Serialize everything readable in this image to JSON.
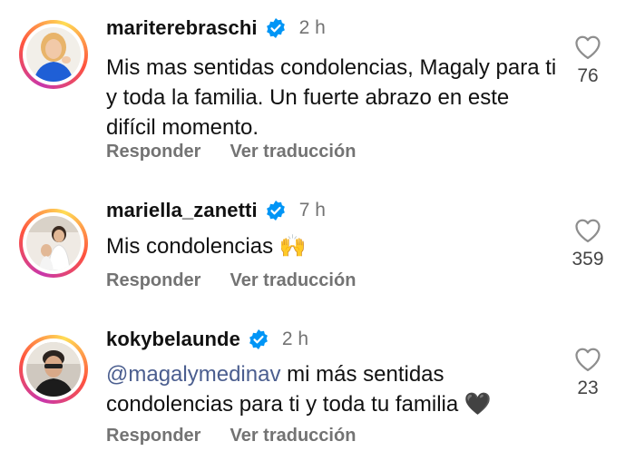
{
  "comments": [
    {
      "username": "mariterebraschi",
      "time": "2 h",
      "text": "Mis mas sentidas condolencias, Magaly para ti y toda la familia. Un fuerte abrazo en este difícil momento.",
      "likes": "76",
      "reply_label": "Responder",
      "translate_label": "Ver traducción"
    },
    {
      "username": "mariella_zanetti",
      "time": "7 h",
      "text": "Mis condolencias 🙌",
      "likes": "359",
      "reply_label": "Responder",
      "translate_label": "Ver traducción"
    },
    {
      "username": "kokybelaunde",
      "time": "2 h",
      "mention": "@magalymedinav",
      "text": " mi más sentidas condolencias para ti y toda tu familia 🖤",
      "likes": "23",
      "reply_label": "Responder",
      "translate_label": "Ver traducción"
    }
  ],
  "icons": {
    "verified": "verified-badge-icon",
    "like": "heart-outline-icon"
  },
  "colors": {
    "verified_blue": "#0095f6",
    "secondary_text": "#737373",
    "mention": "#4b5e8f"
  }
}
